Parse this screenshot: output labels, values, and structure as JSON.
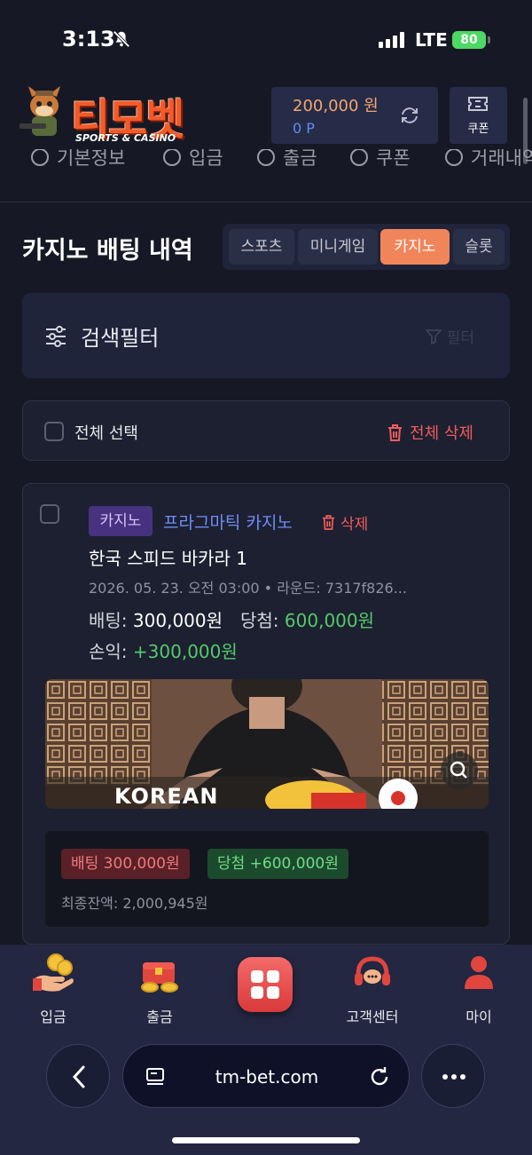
{
  "status": {
    "time": "3:13",
    "network": "LTE",
    "battery": "80"
  },
  "header": {
    "logo_text": "티모벳",
    "logo_sub": "SPORTS & CASINO",
    "balance": "200,000 원",
    "points": "0 P",
    "coupon_label": "쿠폰"
  },
  "nav": [
    "기본정보",
    "입금",
    "출금",
    "쿠폰",
    "거래내역"
  ],
  "page": {
    "title": "카지노 배팅 내역",
    "tabs": [
      {
        "label": "스포츠",
        "active": false
      },
      {
        "label": "미니게임",
        "active": false
      },
      {
        "label": "카지노",
        "active": true
      },
      {
        "label": "슬롯",
        "active": false
      }
    ]
  },
  "filter": {
    "title": "검색필터",
    "button": "필터"
  },
  "select": {
    "label": "전체 선택",
    "delete_all": "전체 삭제"
  },
  "bet": {
    "category": "카지노",
    "provider": "프라그마틱 카지노",
    "delete": "삭제",
    "game": "한국 스피드 바카라 1",
    "meta": "2026. 05. 23. 오전 03:00 • 라운드: 7317f826...",
    "bet_label": "배팅:",
    "bet_amount": "300,000원",
    "win_label": "당첨:",
    "win_amount": "600,000원",
    "profit_label": "손익:",
    "profit_amount": "+300,000원",
    "thumb_text": "KOREAN",
    "pill_bet": "배팅 300,000원",
    "pill_win": "당첨 +600,000원",
    "final_balance": "최종잔액: 2,000,945원"
  },
  "bottom_nav": {
    "deposit": "입금",
    "withdraw": "출금",
    "support": "고객센터",
    "my": "마이"
  },
  "browser": {
    "url": "tm-bet.com"
  },
  "colors": {
    "accent": "#f0855a",
    "win": "#55c96a",
    "loss": "#ef5b5b",
    "link": "#6e8df5"
  }
}
